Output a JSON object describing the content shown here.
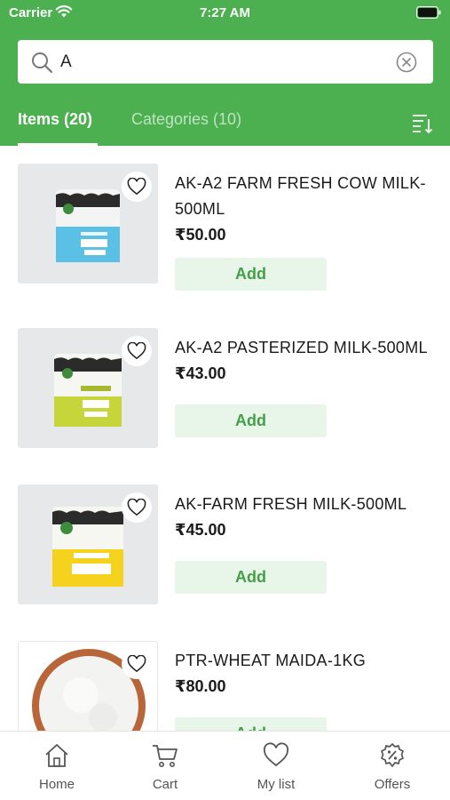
{
  "status_bar": {
    "carrier": "Carrier",
    "time": "7:27 AM"
  },
  "search": {
    "value": "A",
    "placeholder": ""
  },
  "tabs": {
    "items_label": "Items (20)",
    "categories_label": "Categories (10)"
  },
  "products": [
    {
      "name": "AK-A2 FARM FRESH COW MILK-500ML",
      "price": "₹50.00",
      "add_label": "Add",
      "image": "milk-pouch-blue"
    },
    {
      "name": "AK-A2 PASTERIZED MILK-500ML",
      "price": "₹43.00",
      "add_label": "Add",
      "image": "milk-pouch-green"
    },
    {
      "name": "AK-FARM FRESH MILK-500ML",
      "price": "₹45.00",
      "add_label": "Add",
      "image": "milk-pouch-yellow"
    },
    {
      "name": "PTR-WHEAT MAIDA-1KG",
      "price": "₹80.00",
      "add_label": "Add",
      "image": "flour-bowl"
    }
  ],
  "bottom_nav": [
    {
      "label": "Home",
      "icon": "home-icon"
    },
    {
      "label": "Cart",
      "icon": "cart-icon"
    },
    {
      "label": "My list",
      "icon": "heart-icon"
    },
    {
      "label": "Offers",
      "icon": "offers-icon"
    }
  ],
  "colors": {
    "brand_green": "#4caf50",
    "add_button_bg": "#e8f5e9",
    "add_button_text": "#43a047"
  }
}
